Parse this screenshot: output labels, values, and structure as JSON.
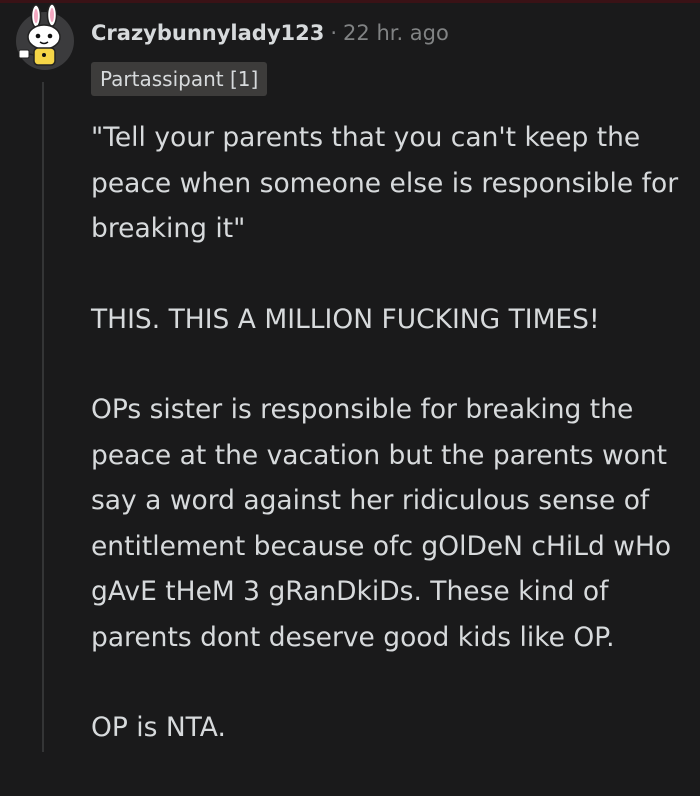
{
  "comment": {
    "username": "Crazybunnylady123",
    "separator": "·",
    "timestamp": "22 hr. ago",
    "flair": "Partassipant [1]",
    "avatar_icon": "bunny-snoo-avatar-icon",
    "paragraphs": [
      "\"Tell your parents that you can't keep the peace when someone else is responsible for breaking it\"",
      "THIS. THIS A MILLION FUCKING TIMES!",
      "OPs sister is responsible for breaking the peace at the vacation but the parents wont say a word against her ridiculous sense of entitlement because ofc gOlDeN cHiLd wHo gAvE tHeM 3 gRanDkiDs. These kind of parents dont deserve good kids like OP.",
      "OP is NTA."
    ]
  },
  "colors": {
    "background": "#1a1a1b",
    "text": "#d7dadc",
    "meta": "#818384",
    "flair_bg": "#3d3c3b",
    "thread_line": "#343536"
  }
}
